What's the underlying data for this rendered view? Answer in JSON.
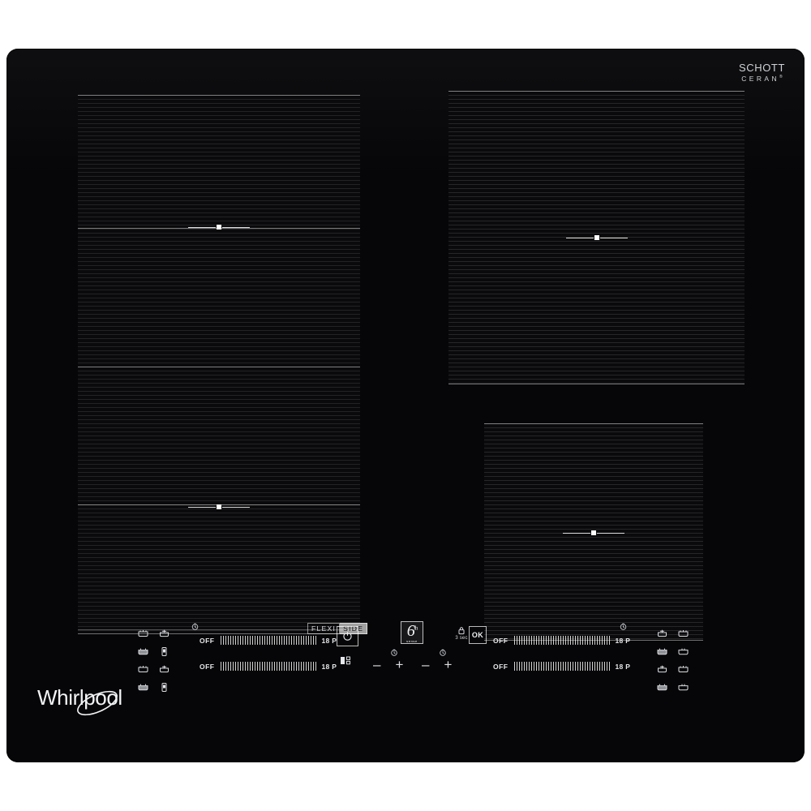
{
  "product": {
    "brand": "Whirlpool",
    "glass_label_line1": "SCHOTT",
    "glass_label_line2": "CERAN",
    "glass_label_mark": "®",
    "feature_badge_part1": "FLEXI",
    "feature_badge_part2": "SIDE",
    "panel_color": "#060608",
    "accent_color": "#ffffff",
    "zone_texture_color": "#1c1c20"
  },
  "cooking_zones": [
    {
      "name": "left-flexi-upper",
      "marker": "center-marker"
    },
    {
      "name": "left-flexi-lower",
      "marker": "center-marker"
    },
    {
      "name": "right-rear",
      "marker": "center-marker"
    },
    {
      "name": "right-front",
      "marker": "center-marker"
    }
  ],
  "controls": {
    "sliders": [
      {
        "id": "left-rear",
        "off_label": "OFF",
        "max_label": "18 P",
        "value": "OFF"
      },
      {
        "id": "left-front",
        "off_label": "OFF",
        "max_label": "18 P",
        "value": "OFF"
      },
      {
        "id": "right-rear",
        "off_label": "OFF",
        "max_label": "18 P",
        "value": "OFF"
      },
      {
        "id": "right-front",
        "off_label": "OFF",
        "max_label": "18 P",
        "value": "OFF"
      }
    ],
    "power_button": {
      "icon": "power-icon",
      "label": ""
    },
    "sixth_sense_button": {
      "digit": "6",
      "superscript": "th",
      "caption": "sense"
    },
    "lock_button": {
      "icon": "lock-icon",
      "hold_label": "3 sec"
    },
    "ok_button": {
      "label": "OK"
    },
    "function_button": {
      "icon": "cooking-function-icon"
    },
    "timers": [
      {
        "id": "timer-left",
        "icon": "clock-icon",
        "minus": "–",
        "plus": "+"
      },
      {
        "id": "timer-right",
        "icon": "clock-icon",
        "minus": "–",
        "plus": "+"
      }
    ],
    "timer_indicators": [
      {
        "id": "indicator-left-slider",
        "icon": "clock-icon"
      },
      {
        "id": "indicator-right-slider",
        "icon": "clock-icon"
      }
    ],
    "left_function_icons": [
      {
        "icon": "melting-pan-icon"
      },
      {
        "icon": "simmer-pan-icon"
      },
      {
        "icon": "keep-warm-pan-icon"
      },
      {
        "icon": "boil-pot-icon"
      },
      {
        "icon": "melting-pan-icon"
      },
      {
        "icon": "simmer-pan-icon"
      },
      {
        "icon": "keep-warm-pan-icon"
      },
      {
        "icon": "boil-pot-icon"
      }
    ],
    "right_function_icons": [
      {
        "icon": "simmer-pan-icon"
      },
      {
        "icon": "melting-pan-icon"
      },
      {
        "icon": "boil-pot-icon"
      },
      {
        "icon": "keep-warm-pan-icon"
      },
      {
        "icon": "simmer-pan-icon"
      },
      {
        "icon": "melting-pan-icon"
      },
      {
        "icon": "boil-pot-icon"
      },
      {
        "icon": "keep-warm-pan-icon"
      }
    ]
  }
}
